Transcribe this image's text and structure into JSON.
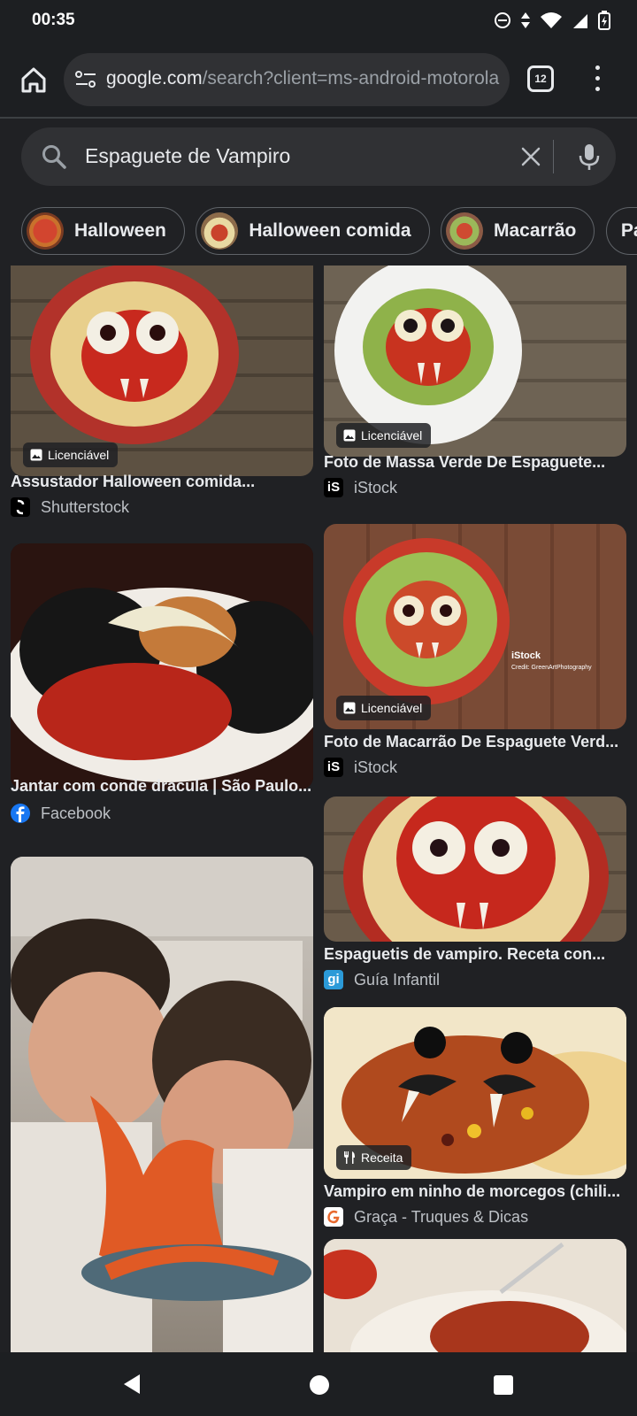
{
  "status_bar": {
    "time": "00:35"
  },
  "browser": {
    "url_host": "google.com",
    "url_rest": "/search?client=ms-android-motorola",
    "tab_count": "12"
  },
  "search": {
    "query": "Espaguete de Vampiro"
  },
  "chips": [
    {
      "label": "Halloween"
    },
    {
      "label": "Halloween comida"
    },
    {
      "label": "Macarrão"
    },
    {
      "label": "Pasta"
    }
  ],
  "results_left": [
    {
      "title": "Assustador Halloween comida...",
      "source": "Shutterstock",
      "badge": "Licenciável",
      "icon": "image-icon"
    },
    {
      "title": "Jantar com conde dracula | São Paulo...",
      "source": "Facebook"
    },
    {
      "title": "",
      "source": ""
    }
  ],
  "results_right": [
    {
      "title": "Foto de Massa Verde De Espaguete...",
      "source": "iStock",
      "badge": "Licenciável",
      "icon": "image-icon"
    },
    {
      "title": "Foto de Macarrão De Espaguete Verd...",
      "source": "iStock",
      "badge": "Licenciável",
      "icon": "image-icon"
    },
    {
      "title": "Espaguetis de vampiro. Receta con...",
      "source": "Guía Infantil"
    },
    {
      "title": "Vampiro em ninho de morcegos (chili...",
      "source": "Graça - Truques & Dicas",
      "badge": "Receita",
      "icon": "fork-knife-icon"
    }
  ],
  "colors": {
    "background": "#202124",
    "chip_border": "#5f6368",
    "text": "#e8eaed",
    "secondary_text": "#bdc1c6"
  }
}
